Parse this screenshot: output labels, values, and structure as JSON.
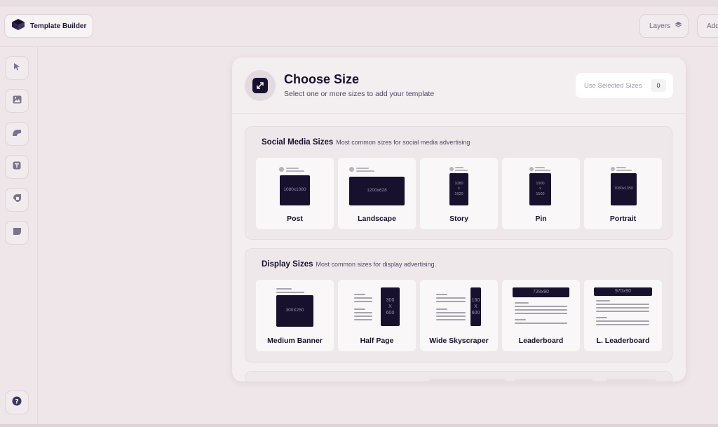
{
  "app": {
    "title": "Template Builder"
  },
  "topbar": {
    "layers_label": "Layers",
    "add_label": "Add"
  },
  "sidebar": {
    "tools": [
      "pointer-tool",
      "image-tool",
      "shape-tool",
      "text-tool",
      "brush-tool",
      "sticker-tool"
    ],
    "help_icon": "help-icon"
  },
  "modal": {
    "title": "Choose Size",
    "subtitle": "Select one or more sizes to add your template",
    "use_selected_label": "Use Selected Sizes",
    "use_selected_count": "0"
  },
  "sections": [
    {
      "title": "Social Media Sizes",
      "description": "Most common sizes for social media advertising",
      "cards": [
        {
          "label": "Post",
          "size": "1080x1080"
        },
        {
          "label": "Landscape",
          "size": "1200x628"
        },
        {
          "label": "Story",
          "size": "1080\nx\n1920"
        },
        {
          "label": "Pin",
          "size": "1000\nx\n1500"
        },
        {
          "label": "Portrait",
          "size": "1080x1350"
        }
      ]
    },
    {
      "title": "Display Sizes",
      "description": "Most common sizes for display advertising.",
      "cards": [
        {
          "label": "Medium Banner",
          "size": "300X250"
        },
        {
          "label": "Half Page",
          "size": "300\nX\n600"
        },
        {
          "label": "Wide Skyscraper",
          "size": "160\nX\n600"
        },
        {
          "label": "Leaderboard",
          "size": "728x90"
        },
        {
          "label": "L. Leaderboard",
          "size": "970x90"
        }
      ]
    }
  ],
  "colors": {
    "background": "#efe6e9",
    "panel": "#f3eef0",
    "dark": "#17112e",
    "card": "#f9f7f8"
  }
}
